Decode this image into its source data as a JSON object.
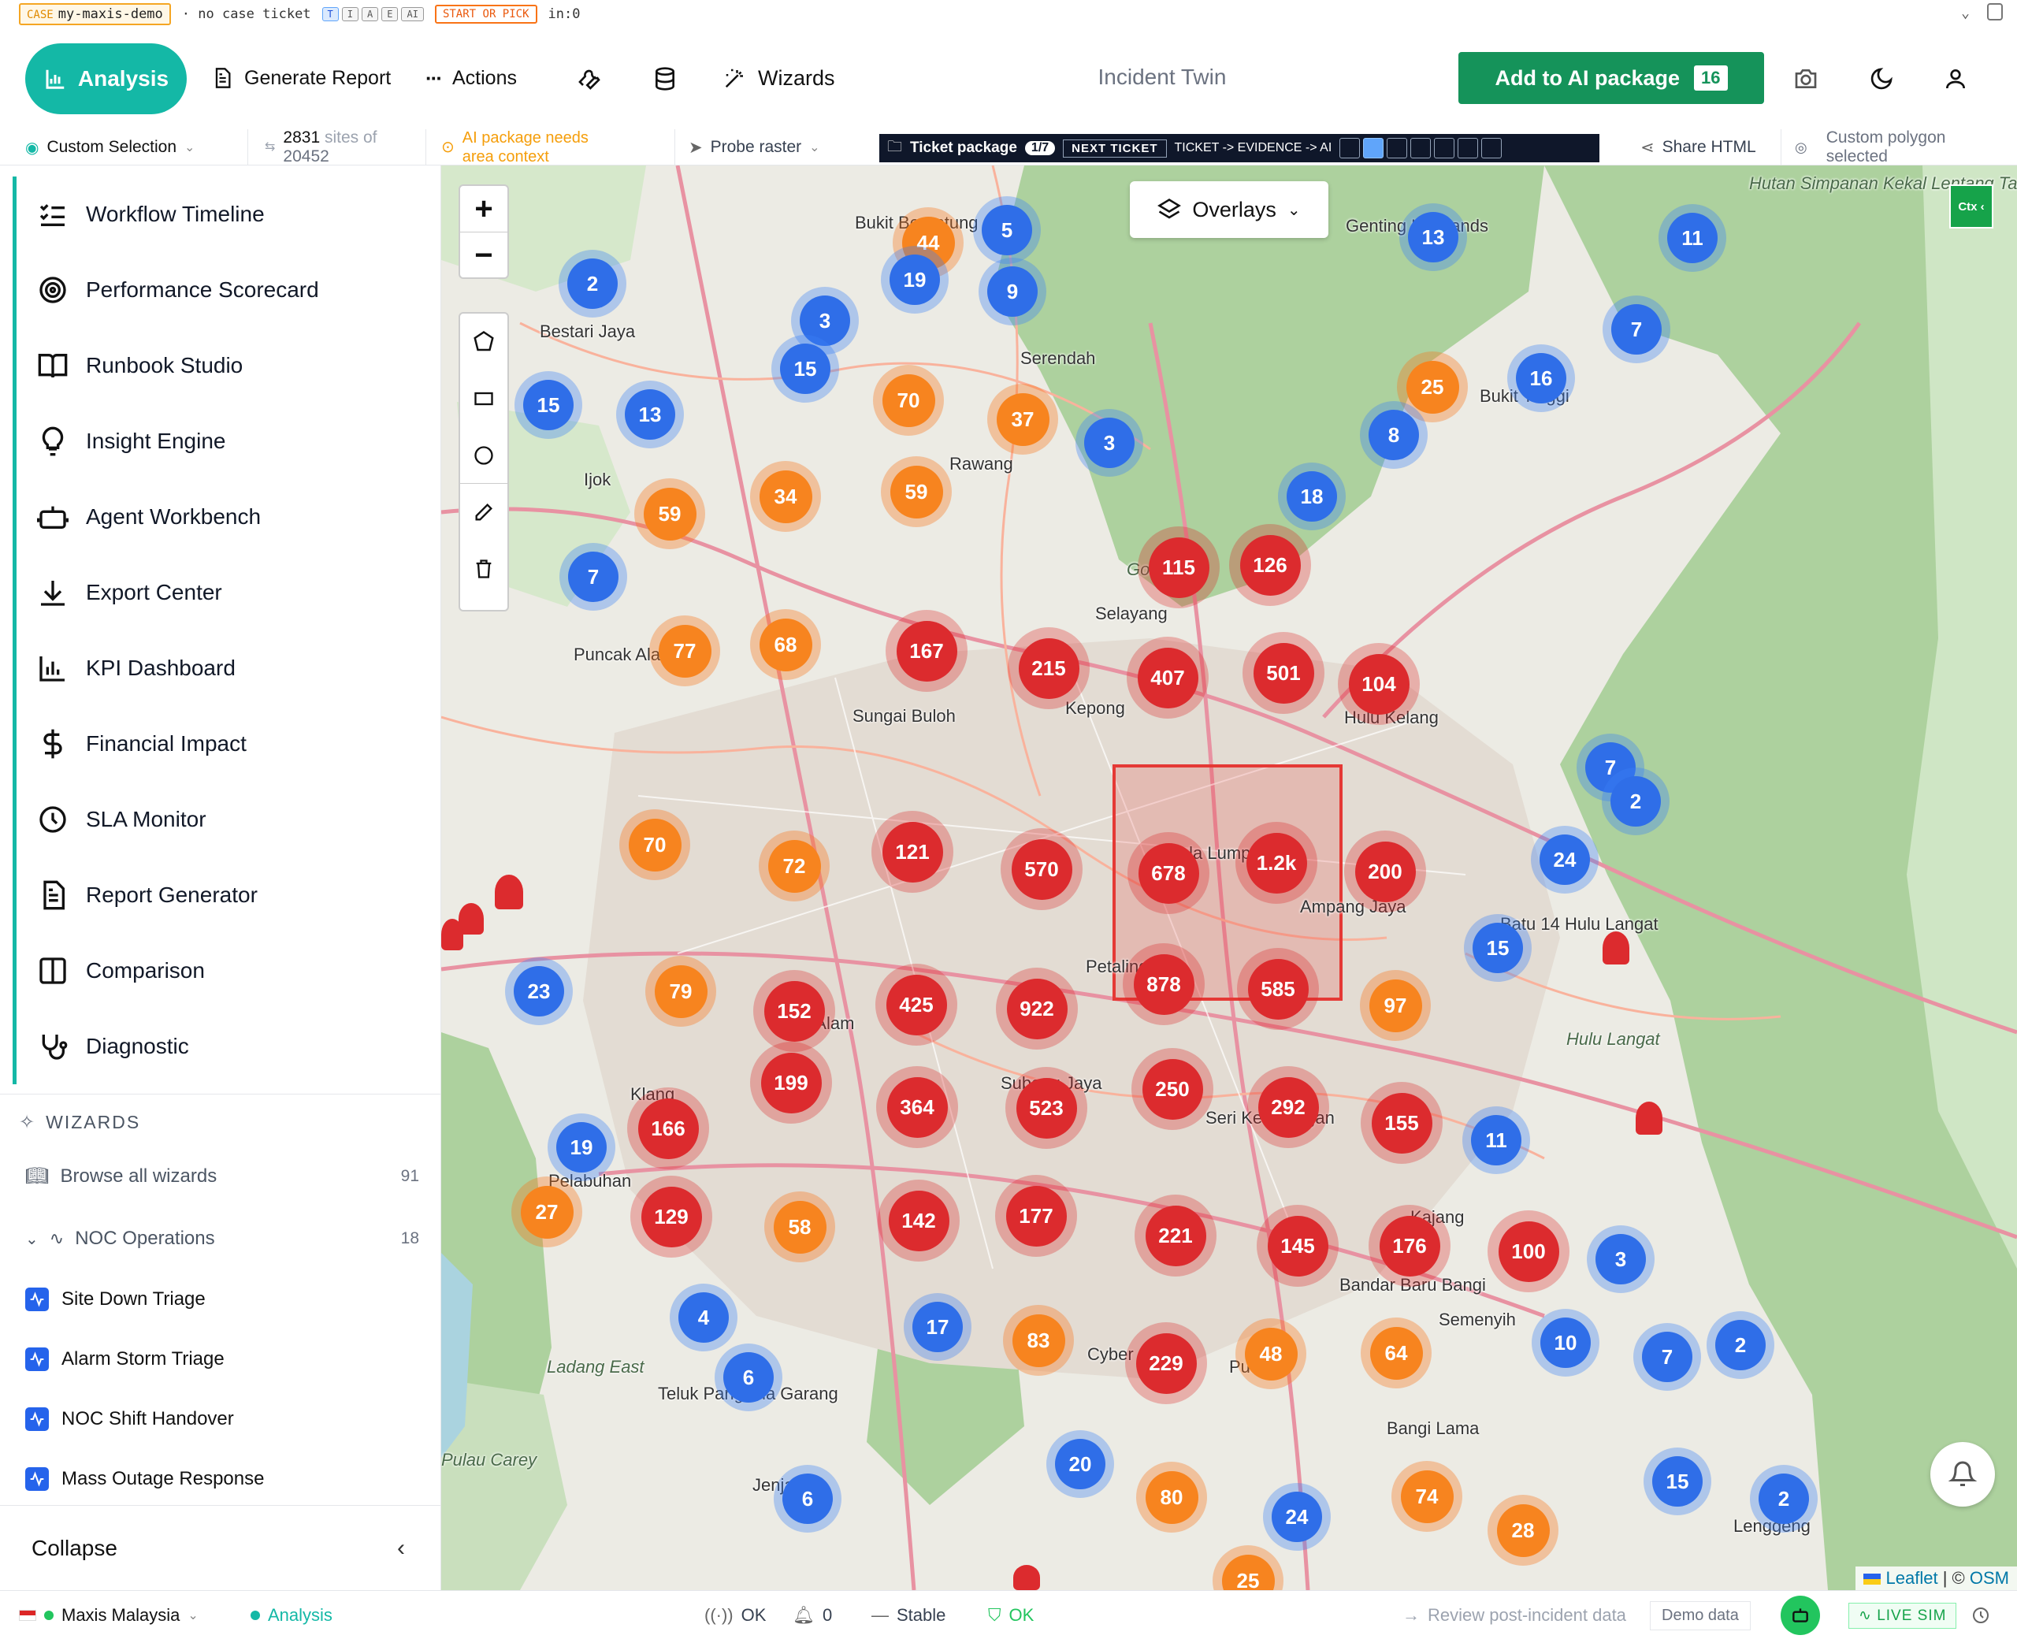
{
  "debug": {
    "case_key": "CASE",
    "case_value": "my-maxis-demo",
    "ticket_status": "· no case ticket",
    "keys": [
      "T",
      "I",
      "A",
      "E",
      "AI"
    ],
    "start_label": "START OR PICK",
    "in_count": "in:0"
  },
  "header": {
    "analysis_label": "Analysis",
    "generate_report_label": "Generate Report",
    "actions_label": "Actions",
    "wizards_label": "Wizards",
    "title": "Incident Twin",
    "ai_package_label": "Add to AI package",
    "ai_package_count": "16"
  },
  "subbar": {
    "selection_label": "Custom Selection",
    "sites_count": "2831",
    "sites_text_1": "sites of",
    "sites_text_2": "20452",
    "warning_line1": "AI package needs",
    "warning_line2": "area context",
    "probe_label": "Probe raster",
    "ticket_label": "Ticket package",
    "ticket_progress": "1/7",
    "next_ticket_label": "NEXT TICKET",
    "flow_label": "TICKET -> EVIDENCE -> AI",
    "share_label": "Share HTML",
    "polygon_line1": "Custom polygon",
    "polygon_line2": "selected"
  },
  "sidebar": {
    "items": [
      {
        "label": "Workflow Timeline",
        "icon": "list-check-icon"
      },
      {
        "label": "Performance Scorecard",
        "icon": "target-icon"
      },
      {
        "label": "Runbook Studio",
        "icon": "book-open-icon"
      },
      {
        "label": "Insight Engine",
        "icon": "lightbulb-icon"
      },
      {
        "label": "Agent Workbench",
        "icon": "bot-icon"
      },
      {
        "label": "Export Center",
        "icon": "download-icon"
      },
      {
        "label": "KPI Dashboard",
        "icon": "bar-chart-icon"
      },
      {
        "label": "Financial Impact",
        "icon": "dollar-icon"
      },
      {
        "label": "SLA Monitor",
        "icon": "clock-icon"
      },
      {
        "label": "Report Generator",
        "icon": "file-text-icon"
      },
      {
        "label": "Comparison",
        "icon": "columns-icon"
      },
      {
        "label": "Diagnostic",
        "icon": "stethoscope-icon"
      }
    ],
    "wizards_heading": "WIZARDS",
    "browse_label": "Browse all wizards",
    "browse_count": "91",
    "group_label": "NOC Operations",
    "group_count": "18",
    "wizard_items": [
      "Site Down Triage",
      "Alarm Storm Triage",
      "NOC Shift Handover",
      "Mass Outage Response"
    ],
    "collapse_label": "Collapse"
  },
  "map": {
    "overlays_label": "Overlays",
    "ctx_label": "Ctx ‹",
    "attribution_leaflet": "Leaflet",
    "attribution_sep": " | © ",
    "attribution_osm": "OSM",
    "place_labels": [
      "Bukit Beruntung",
      "Bestari Jaya",
      "Serendah",
      "Rawang",
      "Ijok",
      "Genting Highlands",
      "Bukit Tinggi",
      "Selayang",
      "Kepong",
      "Sungai Buloh",
      "Kuala Lumpur",
      "Ampang Jaya",
      "Petaling",
      "Shah Alam",
      "Subang Jaya",
      "Klang",
      "Pelabuhan",
      "Seri Kembangan",
      "Kajang",
      "Bandar Baru Bangi",
      "Bangi Lama",
      "Semenyih",
      "Putra",
      "Cyber",
      "Teluk Panglima Garang",
      "Jenjarom",
      "Pulau Carey",
      "Batu 14 Hulu Langat",
      "Hulu Langat",
      "Hulu Kelang",
      "Gombak",
      "Puncak Alam",
      "Hutan Simpanan Kekal Lentang Tambahan",
      "Lenggeng",
      "Ladang East"
    ],
    "clusters": [
      {
        "v": "44",
        "c": "orange"
      },
      {
        "v": "5",
        "c": "blue"
      },
      {
        "v": "2",
        "c": "blue"
      },
      {
        "v": "19",
        "c": "blue"
      },
      {
        "v": "9",
        "c": "blue"
      },
      {
        "v": "3",
        "c": "blue"
      },
      {
        "v": "15",
        "c": "blue"
      },
      {
        "v": "70",
        "c": "orange"
      },
      {
        "v": "15",
        "c": "blue"
      },
      {
        "v": "13",
        "c": "blue"
      },
      {
        "v": "37",
        "c": "orange"
      },
      {
        "v": "3",
        "c": "blue"
      },
      {
        "v": "34",
        "c": "orange"
      },
      {
        "v": "59",
        "c": "orange"
      },
      {
        "v": "59",
        "c": "orange"
      },
      {
        "v": "7",
        "c": "blue"
      },
      {
        "v": "77",
        "c": "orange"
      },
      {
        "v": "68",
        "c": "orange"
      },
      {
        "v": "167",
        "c": "red"
      },
      {
        "v": "215",
        "c": "red"
      },
      {
        "v": "407",
        "c": "red"
      },
      {
        "v": "501",
        "c": "red"
      },
      {
        "v": "104",
        "c": "red"
      },
      {
        "v": "115",
        "c": "red"
      },
      {
        "v": "126",
        "c": "red"
      },
      {
        "v": "70",
        "c": "orange"
      },
      {
        "v": "72",
        "c": "orange"
      },
      {
        "v": "121",
        "c": "red"
      },
      {
        "v": "570",
        "c": "red"
      },
      {
        "v": "678",
        "c": "red"
      },
      {
        "v": "1.2k",
        "c": "red"
      },
      {
        "v": "200",
        "c": "red"
      },
      {
        "v": "23",
        "c": "blue"
      },
      {
        "v": "79",
        "c": "orange"
      },
      {
        "v": "152",
        "c": "red"
      },
      {
        "v": "425",
        "c": "red"
      },
      {
        "v": "922",
        "c": "red"
      },
      {
        "v": "878",
        "c": "red"
      },
      {
        "v": "585",
        "c": "red"
      },
      {
        "v": "97",
        "c": "orange"
      },
      {
        "v": "199",
        "c": "red"
      },
      {
        "v": "364",
        "c": "red"
      },
      {
        "v": "523",
        "c": "red"
      },
      {
        "v": "250",
        "c": "red"
      },
      {
        "v": "292",
        "c": "red"
      },
      {
        "v": "155",
        "c": "red"
      },
      {
        "v": "11",
        "c": "blue"
      },
      {
        "v": "19",
        "c": "blue"
      },
      {
        "v": "166",
        "c": "red"
      },
      {
        "v": "27",
        "c": "orange"
      },
      {
        "v": "129",
        "c": "red"
      },
      {
        "v": "58",
        "c": "orange"
      },
      {
        "v": "142",
        "c": "red"
      },
      {
        "v": "177",
        "c": "red"
      },
      {
        "v": "221",
        "c": "red"
      },
      {
        "v": "145",
        "c": "red"
      },
      {
        "v": "176",
        "c": "red"
      },
      {
        "v": "100",
        "c": "red"
      },
      {
        "v": "3",
        "c": "blue"
      },
      {
        "v": "4",
        "c": "blue"
      },
      {
        "v": "17",
        "c": "blue"
      },
      {
        "v": "83",
        "c": "orange"
      },
      {
        "v": "229",
        "c": "red"
      },
      {
        "v": "48",
        "c": "orange"
      },
      {
        "v": "64",
        "c": "orange"
      },
      {
        "v": "10",
        "c": "blue"
      },
      {
        "v": "7",
        "c": "blue"
      },
      {
        "v": "2",
        "c": "blue"
      },
      {
        "v": "6",
        "c": "blue"
      },
      {
        "v": "20",
        "c": "blue"
      },
      {
        "v": "80",
        "c": "orange"
      },
      {
        "v": "24",
        "c": "blue"
      },
      {
        "v": "74",
        "c": "orange"
      },
      {
        "v": "28",
        "c": "orange"
      },
      {
        "v": "15",
        "c": "blue"
      },
      {
        "v": "2",
        "c": "blue"
      },
      {
        "v": "6",
        "c": "blue"
      },
      {
        "v": "13",
        "c": "blue"
      },
      {
        "v": "11",
        "c": "blue"
      },
      {
        "v": "7",
        "c": "blue"
      },
      {
        "v": "25",
        "c": "orange"
      },
      {
        "v": "16",
        "c": "blue"
      },
      {
        "v": "8",
        "c": "blue"
      },
      {
        "v": "18",
        "c": "blue"
      },
      {
        "v": "7",
        "c": "blue"
      },
      {
        "v": "2",
        "c": "blue"
      },
      {
        "v": "24",
        "c": "blue"
      },
      {
        "v": "15",
        "c": "blue"
      },
      {
        "v": "25",
        "c": "orange"
      }
    ]
  },
  "status": {
    "region_label": "Maxis Malaysia",
    "mode_label": "Analysis",
    "signal_label": "OK",
    "alerts_count": "0",
    "trend_label": "Stable",
    "health_label": "OK",
    "review_label": "Review post-incident data",
    "demo_label": "Demo data",
    "live_label": "LIVE SIM"
  },
  "colors": {
    "accent": "#14b8a6",
    "ai_green": "#15935a",
    "cluster_red": "#dc2b2e",
    "cluster_orange": "#f7841f",
    "cluster_blue": "#2f6ee8"
  }
}
